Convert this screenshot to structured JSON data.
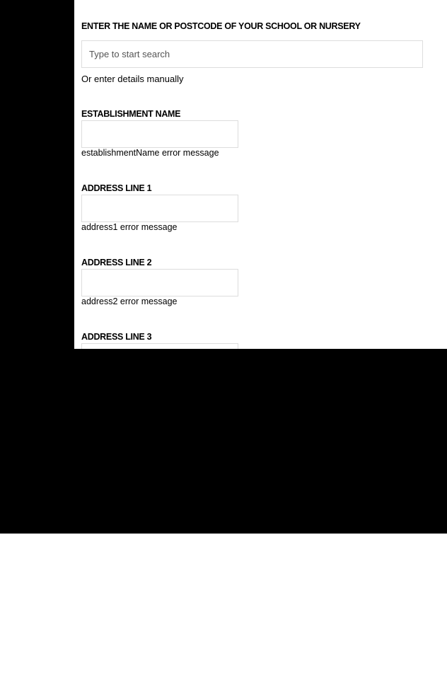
{
  "search": {
    "heading": "ENTER THE NAME OR POSTCODE OF YOUR SCHOOL OR NURSERY",
    "placeholder": "Type to start search",
    "manual_link": "Or enter details manually"
  },
  "fields": {
    "establishment_name": {
      "label": "ESTABLISHMENT NAME",
      "value": "",
      "error": "establishmentName error message"
    },
    "address1": {
      "label": "ADDRESS LINE 1",
      "value": "",
      "error": "address1 error message"
    },
    "address2": {
      "label": "ADDRESS LINE 2",
      "value": "",
      "error": "address2 error message"
    },
    "address3": {
      "label": "ADDRESS LINE 3",
      "value": ""
    }
  },
  "colors": {
    "backdrop": "#000000",
    "panel": "#ffffff",
    "input_border": "#dddddd",
    "text": "#000000"
  }
}
